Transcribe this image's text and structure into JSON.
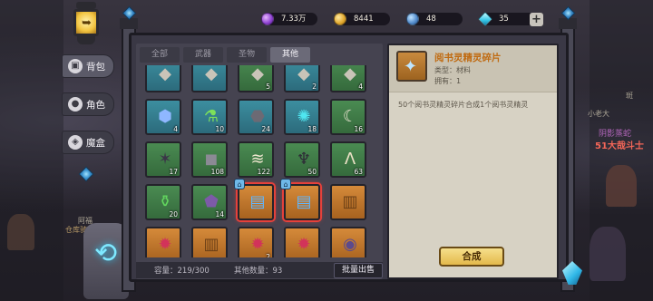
{
  "resources": [
    {
      "icon": "gem-icon",
      "value": "7.33万"
    },
    {
      "icon": "gold-coin-icon",
      "value": "8441"
    },
    {
      "icon": "blue-orb-icon",
      "value": "48"
    },
    {
      "icon": "diamond-icon",
      "value": "35"
    }
  ],
  "add_button": "+",
  "side_nav": [
    {
      "label": "背包",
      "icon": "backpack-icon",
      "active": true
    },
    {
      "label": "角色",
      "icon": "character-icon",
      "active": false
    },
    {
      "label": "魔盒",
      "icon": "magic-box-icon",
      "active": false
    }
  ],
  "tabs": [
    {
      "label": "全部",
      "active": false
    },
    {
      "label": "武器",
      "active": false
    },
    {
      "label": "圣物",
      "active": false
    },
    {
      "label": "其他",
      "active": true
    }
  ],
  "items": [
    {
      "icon": "partial-item-icon",
      "count": "",
      "quality": "blue"
    },
    {
      "icon": "partial-item-icon",
      "count": "",
      "quality": "blue"
    },
    {
      "icon": "partial-item-icon",
      "count": "5",
      "quality": "green"
    },
    {
      "icon": "partial-item-icon",
      "count": "2",
      "quality": "blue"
    },
    {
      "icon": "partial-item-icon",
      "count": "4",
      "quality": "green"
    },
    {
      "icon": "blue-crystal-icon",
      "count": "4",
      "quality": "blue"
    },
    {
      "icon": "green-potion-icon",
      "count": "10",
      "quality": "blue"
    },
    {
      "icon": "dark-ore-icon",
      "count": "24",
      "quality": "blue"
    },
    {
      "icon": "cyan-ore-icon",
      "count": "18",
      "quality": "blue"
    },
    {
      "icon": "fang-icon",
      "count": "16",
      "quality": "green"
    },
    {
      "icon": "dark-claw-icon",
      "count": "17",
      "quality": "green"
    },
    {
      "icon": "stone-slab-icon",
      "count": "108",
      "quality": "green"
    },
    {
      "icon": "bone-claws-icon",
      "count": "122",
      "quality": "green"
    },
    {
      "icon": "shadow-horn-icon",
      "count": "50",
      "quality": "green"
    },
    {
      "icon": "horns-icon",
      "count": "63",
      "quality": "green"
    },
    {
      "icon": "green-flask-icon",
      "count": "20",
      "quality": "green"
    },
    {
      "icon": "purple-rock-icon",
      "count": "14",
      "quality": "green"
    },
    {
      "icon": "blue-chest-icon",
      "count": "",
      "quality": "orange",
      "selected": true,
      "locked": true
    },
    {
      "icon": "blue-chest-icon",
      "count": "",
      "quality": "orange",
      "selected": true,
      "locked": true
    },
    {
      "icon": "wooden-chest-icon",
      "count": "",
      "quality": "orange"
    },
    {
      "icon": "magic-lantern-icon",
      "count": "",
      "quality": "orange"
    },
    {
      "icon": "wooden-chest-icon",
      "count": "",
      "quality": "orange"
    },
    {
      "icon": "magic-lantern-icon",
      "count": "2",
      "quality": "orange"
    },
    {
      "icon": "magic-lantern-icon",
      "count": "",
      "quality": "orange"
    },
    {
      "icon": "purple-device-icon",
      "count": "",
      "quality": "orange"
    }
  ],
  "footer": {
    "capacity_label": "容量：219/300",
    "other_label": "其他数量：93",
    "batch_sell": "批量出售"
  },
  "detail": {
    "name": "阅书灵精灵碎片",
    "type": "类型：材料",
    "owned": "拥有：1",
    "description": "50个阅书灵精灵碎片合成1个阅书灵精灵",
    "compose_button": "合成",
    "icon": "puzzle-piece-icon"
  },
  "scene_labels": [
    "阴影蒸蛇",
    "51大哉斗士",
    "小老大",
    "斑",
    "仓库骑士",
    "阿福"
  ],
  "colors": {
    "accent_orange": "#c06b12",
    "selected_border": "#e5413b",
    "compose_button": "#e4b94b"
  }
}
